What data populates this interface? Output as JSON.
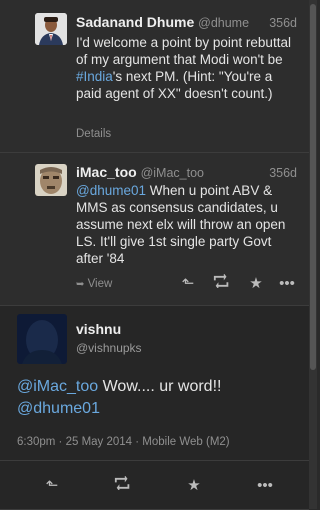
{
  "tweets": [
    {
      "name": "Sadanand Dhume",
      "handle": "@dhume",
      "age": "356d",
      "text_parts": [
        "I'd welcome a point by point rebuttal of my argument that Modi won't be ",
        "#India",
        "'s next PM. (Hint: \"You're a paid agent of XX\" doesn't count.)"
      ],
      "footer": "Details"
    },
    {
      "name": "iMac_too",
      "handle": "@iMac_too",
      "age": "356d",
      "mention": "@dhume01",
      "text": " When u point ABV & MMS as consensus candidates, u assume next elx will throw an open LS. It'll give 1st single party Govt after '84",
      "view_label": "View"
    }
  ],
  "focus_tweet": {
    "name": "vishnu",
    "handle": "@vishnupks",
    "mention1": "@iMac_too",
    "text": " Wow.... ur word!!",
    "mention2": "@dhume01",
    "meta": "6:30pm · 25 May 2014 · Mobile Web (M2)"
  },
  "icons": [
    "reply-icon",
    "retweet-icon",
    "favorite-icon",
    "more-icon",
    "expand-arrow-icon"
  ],
  "colors": {
    "link": "#6aa8de",
    "background": "#2b2b2b"
  }
}
